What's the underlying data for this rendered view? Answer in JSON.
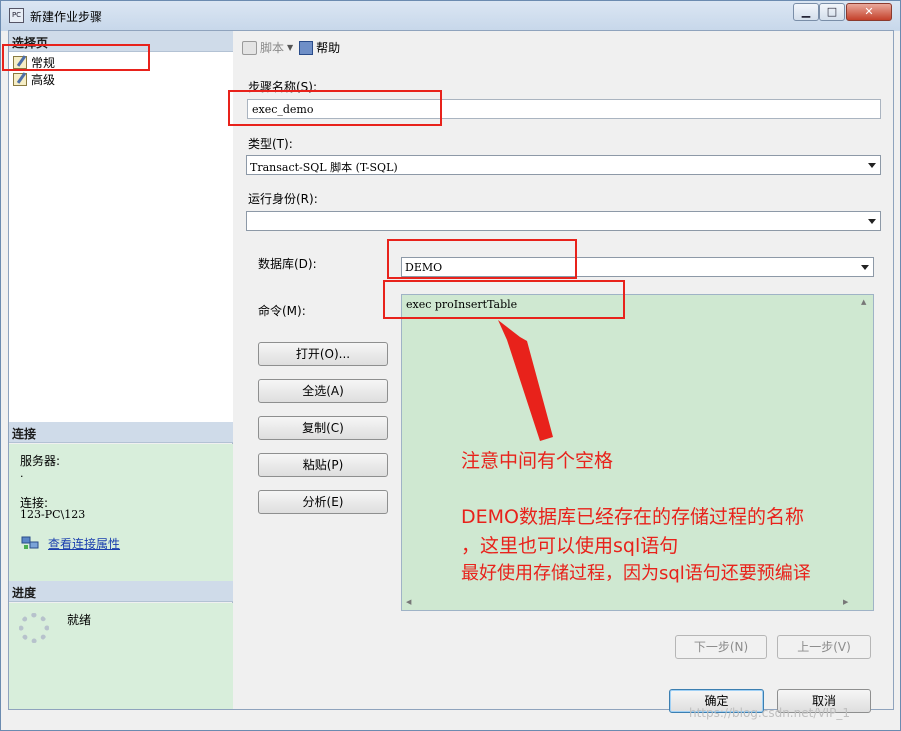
{
  "window": {
    "title": "新建作业步骤",
    "icon_text": "PC",
    "controls": [
      "minimize-icon",
      "maximize-icon",
      "close-icon"
    ]
  },
  "left": {
    "select_page_header": "选择页",
    "pages": [
      {
        "label": "常规",
        "icon": "page-settings-icon"
      },
      {
        "label": "高级",
        "icon": "page-settings-icon"
      }
    ],
    "connection": {
      "header": "连接",
      "server_label": "服务器:",
      "server_value": ".",
      "connection_label": "连接:",
      "connection_value": "123-PC\\123",
      "view_link": "查看连接属性"
    },
    "progress": {
      "header": "进度",
      "status": "就绪"
    }
  },
  "toolbar": {
    "script_label": "脚本",
    "help_label": "帮助"
  },
  "form": {
    "step_name_label": "步骤名称(S):",
    "step_name_value": "exec_demo",
    "type_label": "类型(T):",
    "type_value": "Transact-SQL 脚本 (T-SQL)",
    "run_as_label": "运行身份(R):",
    "run_as_value": "",
    "database_label": "数据库(D):",
    "database_value": "DEMO",
    "command_label": "命令(M):",
    "command_value": "exec proInsertTable"
  },
  "buttons": {
    "open": "打开(O)...",
    "select_all": "全选(A)",
    "copy": "复制(C)",
    "paste": "粘贴(P)",
    "parse": "分析(E)",
    "next": "下一步(N)",
    "prev": "上一步(V)",
    "ok": "确定",
    "cancel": "取消"
  },
  "annotations": {
    "line1": "注意中间有个空格",
    "line2": "DEMO数据库已经存在的存储过程的名称",
    "line3": "，这里也可以使用sql语句",
    "line4": "最好使用存储过程，因为sql语句还要预编译",
    "color": "#e8221b"
  },
  "watermark": "https://blog.csdn.net/VIP_1"
}
